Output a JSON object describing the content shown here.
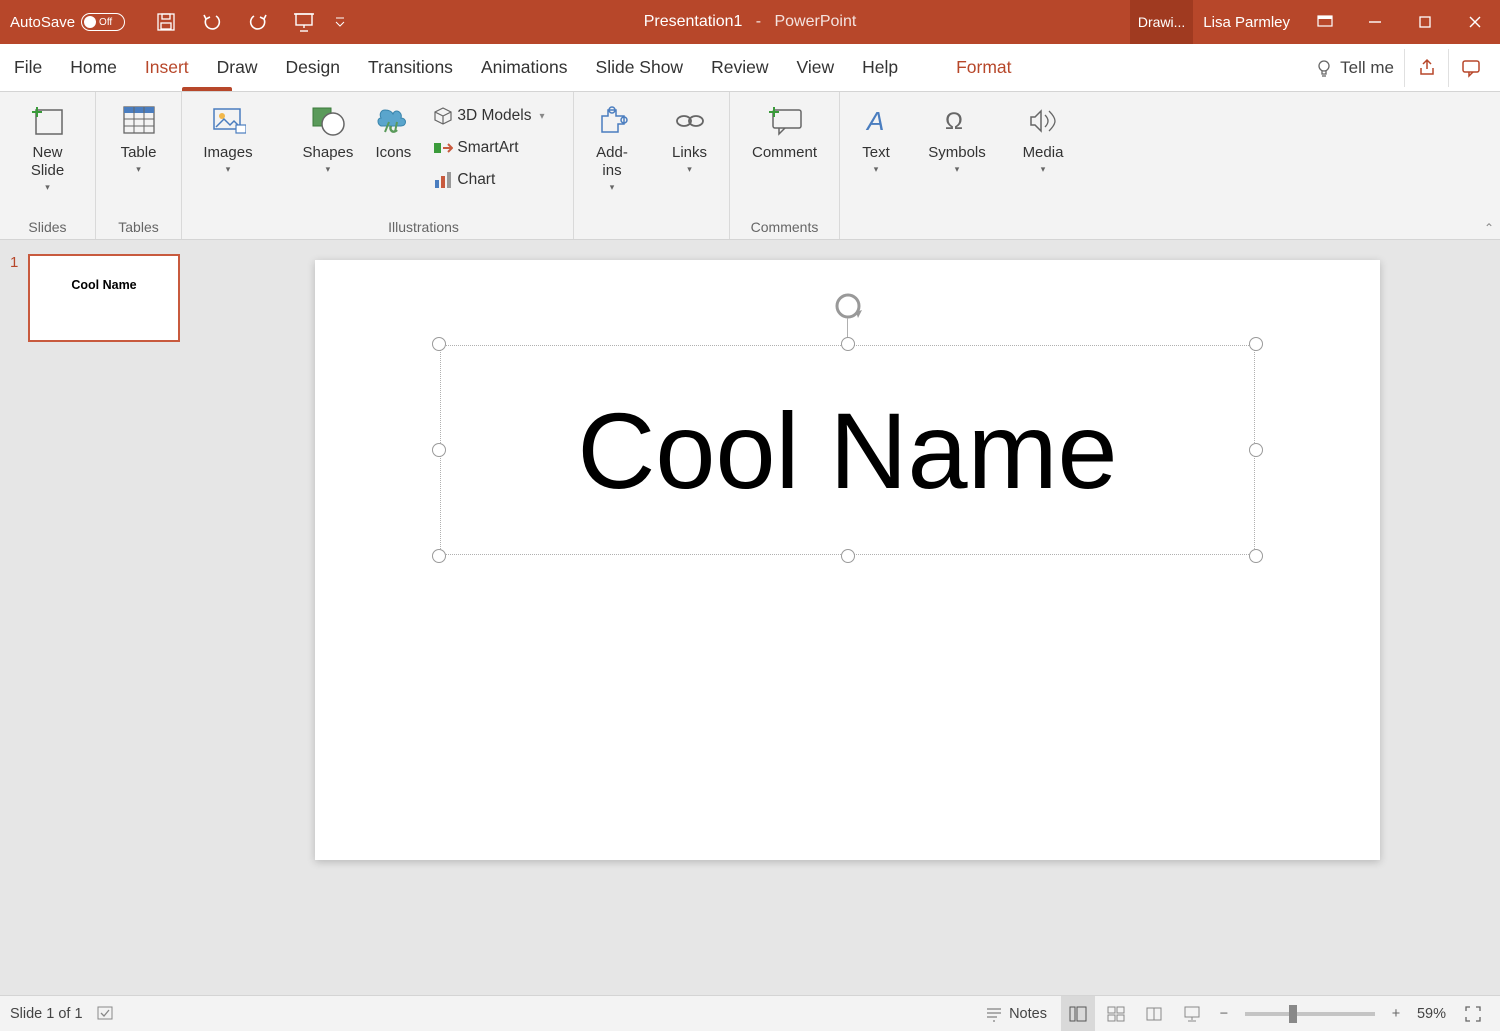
{
  "titlebar": {
    "autosave_label": "AutoSave",
    "autosave_state": "Off",
    "doc_name": "Presentation1",
    "app_name": "PowerPoint",
    "drawing_tools": "Drawi...",
    "user": "Lisa Parmley"
  },
  "tabs": {
    "file": "File",
    "home": "Home",
    "insert": "Insert",
    "draw": "Draw",
    "design": "Design",
    "transitions": "Transitions",
    "animations": "Animations",
    "slideshow": "Slide Show",
    "review": "Review",
    "view": "View",
    "help": "Help",
    "format": "Format",
    "tellme": "Tell me"
  },
  "ribbon": {
    "slides": {
      "new_slide": "New\nSlide",
      "group": "Slides"
    },
    "tables": {
      "table": "Table",
      "group": "Tables"
    },
    "images": {
      "label": "Images"
    },
    "illustrations": {
      "shapes": "Shapes",
      "icons": "Icons",
      "models": "3D Models",
      "smartart": "SmartArt",
      "chart": "Chart",
      "group": "Illustrations"
    },
    "addins": {
      "label": "Add-\nins"
    },
    "links": {
      "label": "Links"
    },
    "comments": {
      "comment": "Comment",
      "group": "Comments"
    },
    "text": {
      "label": "Text"
    },
    "symbols": {
      "label": "Symbols"
    },
    "media": {
      "label": "Media"
    }
  },
  "thumbnails": [
    {
      "number": "1",
      "text": "Cool Name"
    }
  ],
  "slide": {
    "title": "Cool Name"
  },
  "statusbar": {
    "slide_info": "Slide 1 of 1",
    "notes": "Notes",
    "zoom": "59%"
  }
}
